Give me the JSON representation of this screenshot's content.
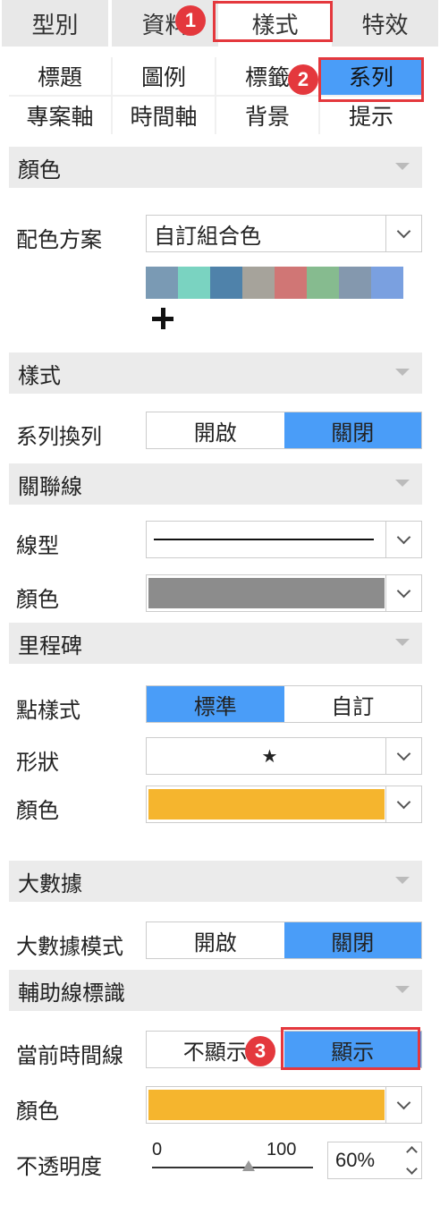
{
  "top_tabs": [
    "型別",
    "資料",
    "樣式",
    "特效"
  ],
  "sub_tabs": [
    "標題",
    "圖例",
    "標籤",
    "系列",
    "專案軸",
    "時間軸",
    "背景",
    "提示"
  ],
  "badges": [
    "1",
    "2",
    "3"
  ],
  "color_section": {
    "title": "顏色",
    "scheme_label": "配色方案",
    "scheme_value": "自訂組合色",
    "swatches": [
      "#7a9ab4",
      "#7ad3c1",
      "#4f82aa",
      "#a6a39b",
      "#d07675",
      "#86bb8f",
      "#8498ae",
      "#7aa0e0"
    ]
  },
  "style_section": {
    "title": "樣式",
    "series_wrap_label": "系列換列",
    "on_label": "開啟",
    "off_label": "關閉"
  },
  "link_section": {
    "title": "關聯線",
    "line_type_label": "線型",
    "color_label": "顏色",
    "line_color": "#8c8c8c"
  },
  "milestone_section": {
    "title": "里程碑",
    "point_style_label": "點樣式",
    "standard_label": "標準",
    "custom_label": "自訂",
    "shape_label": "形狀",
    "shape_value": "★",
    "color_label": "顏色",
    "color": "#f5b52e"
  },
  "bigdata_section": {
    "title": "大數據",
    "mode_label": "大數據模式",
    "on_label": "開啟",
    "off_label": "關閉"
  },
  "guideline_section": {
    "title": "輔助線標識",
    "current_time_label": "當前時間線",
    "hide_label": "不顯示",
    "show_label": "顯示",
    "color_label": "顏色",
    "color": "#f5b52e",
    "opacity_label": "不透明度",
    "slider_min": "0",
    "slider_max": "100",
    "opacity_value": "60%",
    "opacity_fraction": 0.6
  },
  "colors": {
    "accent": "#4a9df8",
    "highlight": "#e4383d"
  }
}
